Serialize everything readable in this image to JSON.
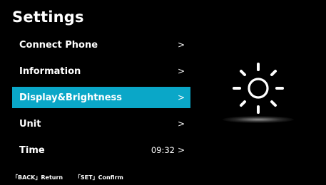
{
  "header": {
    "title": "Settings"
  },
  "menu": {
    "items": [
      {
        "label": "Connect Phone",
        "value": "",
        "chevron": ">"
      },
      {
        "label": "Information",
        "value": "",
        "chevron": ">"
      },
      {
        "label": "Display&Brightness",
        "value": "",
        "chevron": ">"
      },
      {
        "label": "Unit",
        "value": "",
        "chevron": ">"
      },
      {
        "label": "Time",
        "value": "09:32",
        "chevron": ">"
      }
    ],
    "selected_index": 2
  },
  "footer": {
    "back_hint": "「BACK」Return",
    "set_hint": "「SET」Confirm"
  },
  "preview": {
    "icon": "sun-icon"
  },
  "colors": {
    "accent": "#0aa7c8",
    "background": "#000000",
    "text": "#ffffff"
  }
}
